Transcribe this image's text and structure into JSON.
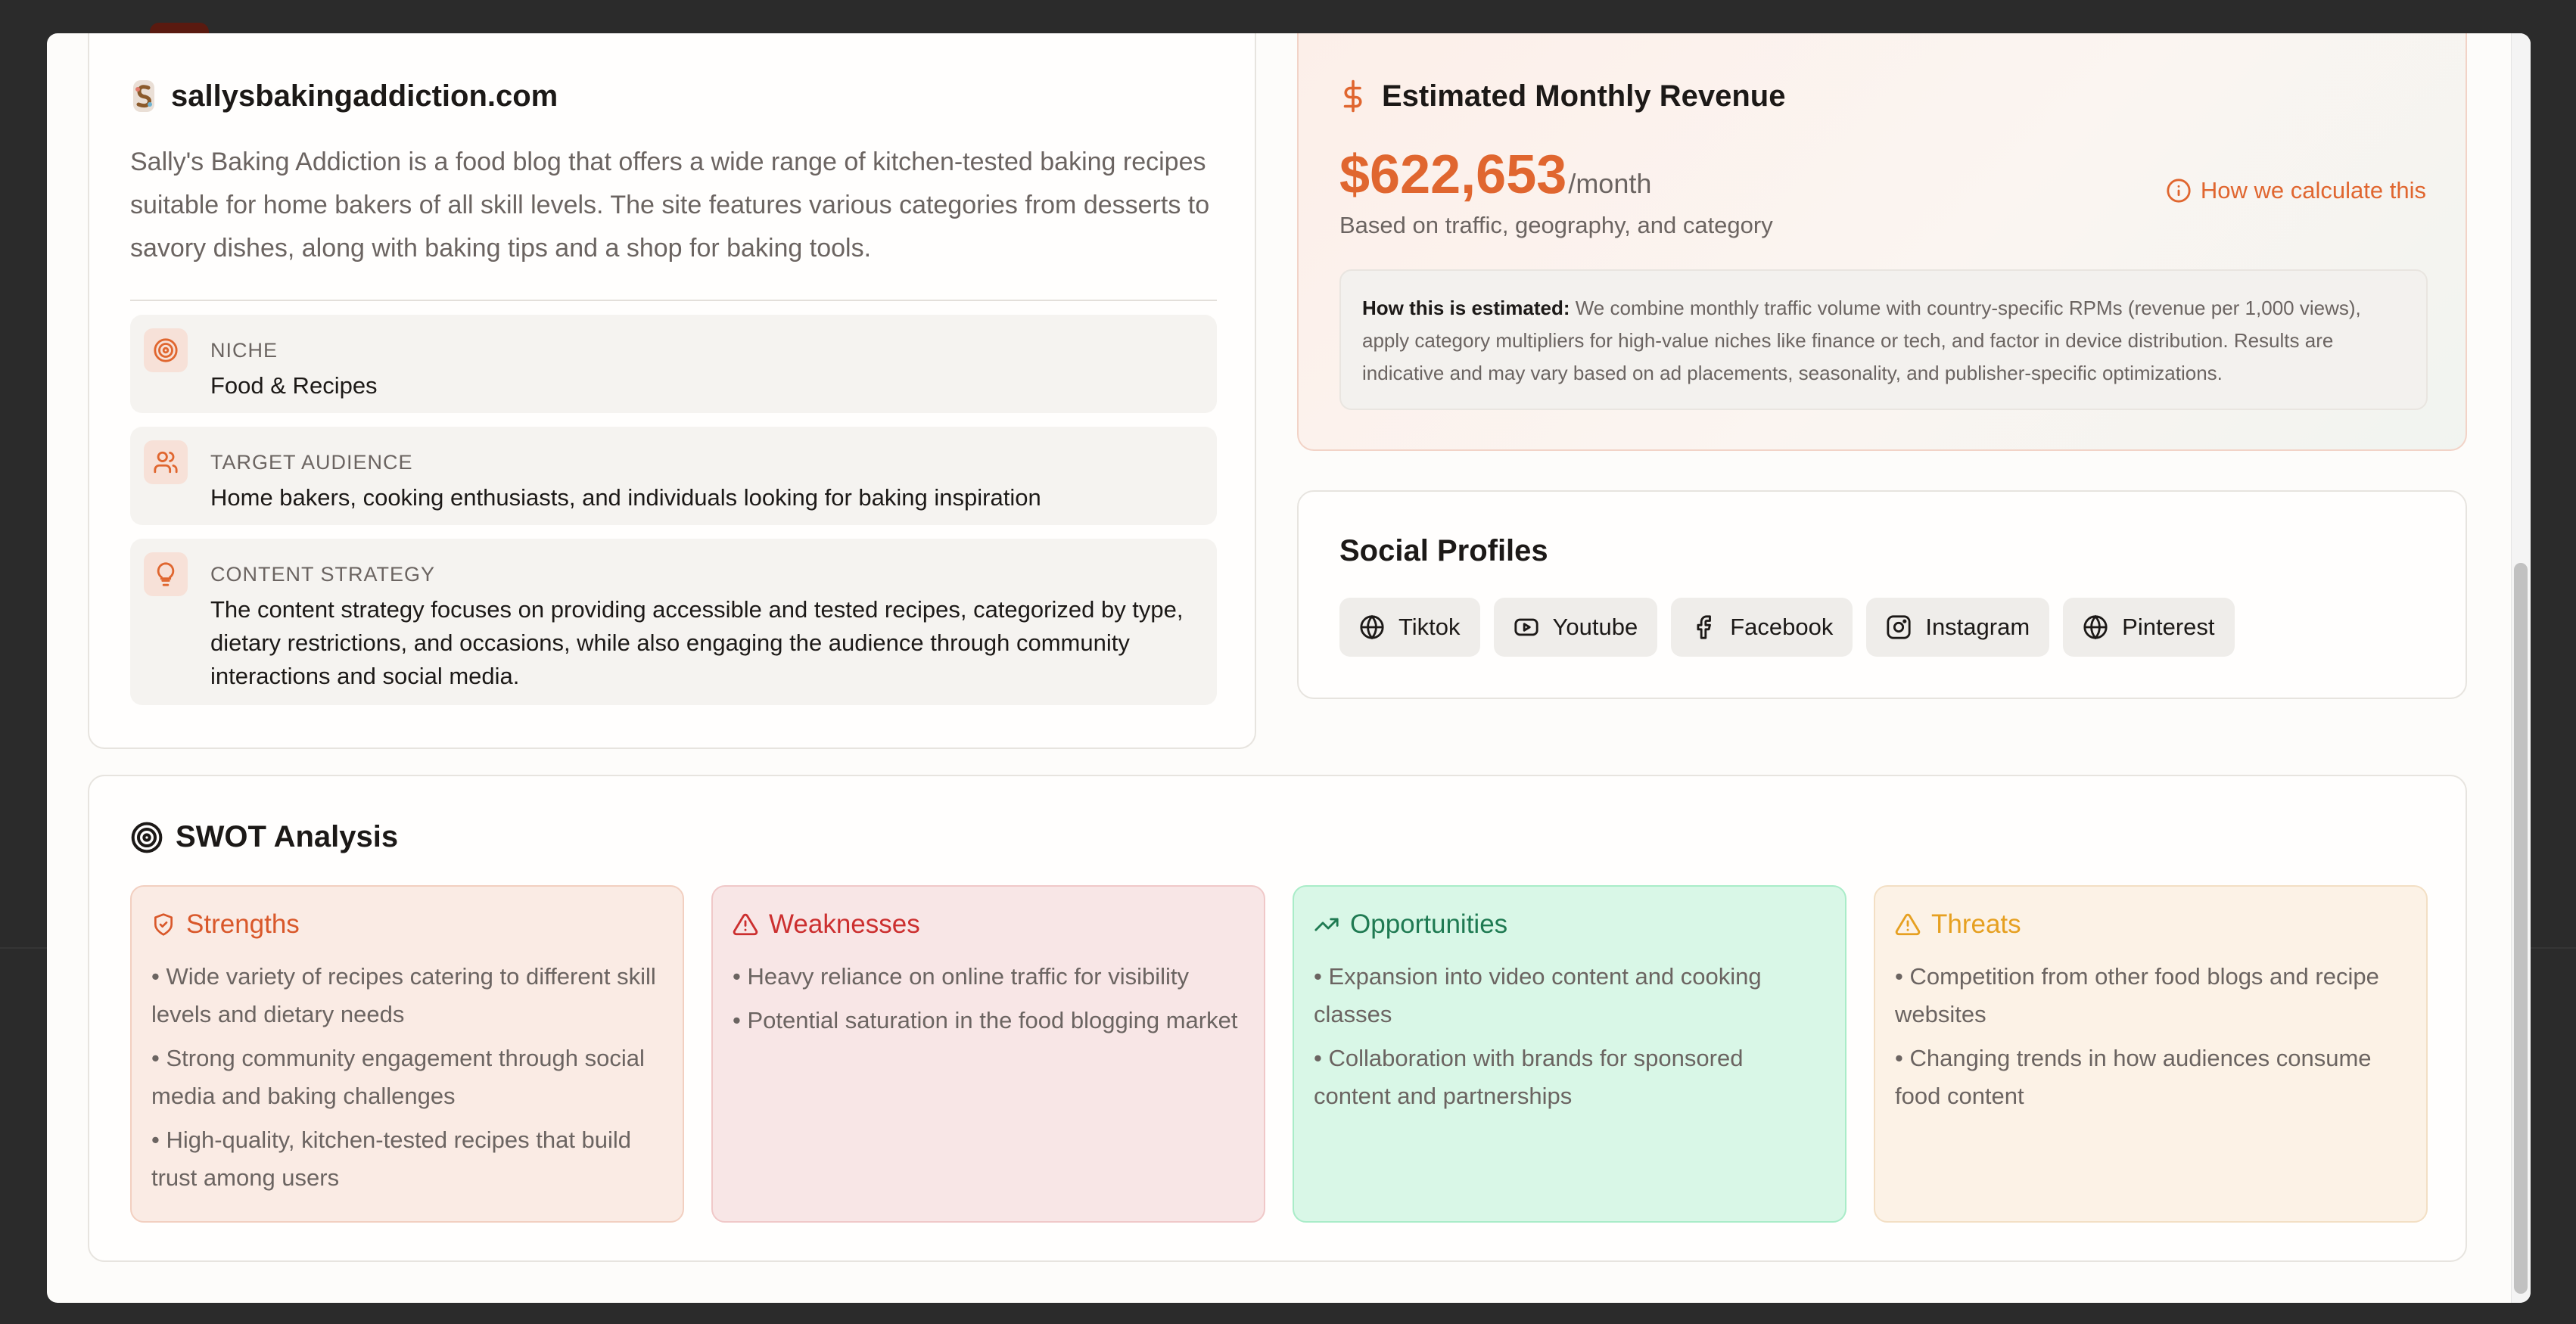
{
  "site": {
    "domain": "sallysbakingaddiction.com",
    "description": "Sally's Baking Addiction is a food blog that offers a wide range of kitchen-tested baking recipes suitable for home bakers of all skill levels. The site features various categories from desserts to savory dishes, along with baking tips and a shop for baking tools.",
    "details": [
      {
        "label": "NICHE",
        "value": "Food & Recipes",
        "icon": "target-icon"
      },
      {
        "label": "TARGET AUDIENCE",
        "value": "Home bakers, cooking enthusiasts, and individuals looking for baking inspiration",
        "icon": "users-icon"
      },
      {
        "label": "CONTENT STRATEGY",
        "value": "The content strategy focuses on providing accessible and tested recipes, categorized by type, dietary restrictions, and occasions, while also engaging the audience through community interactions and social media.",
        "icon": "lightbulb-icon"
      }
    ]
  },
  "revenue": {
    "title": "Estimated Monthly Revenue",
    "amount": "$622,653",
    "period": "/month",
    "basis": "Based on traffic, geography, and category",
    "link_label": "How we calculate this",
    "note_label": "How this is estimated:",
    "note_text": "We combine monthly traffic volume with country-specific RPMs (revenue per 1,000 views), apply category multipliers for high-value niches like finance or tech, and factor in device distribution. Results are indicative and may vary based on ad placements, seasonality, and publisher-specific optimizations."
  },
  "social": {
    "title": "Social Profiles",
    "profiles": [
      {
        "label": "Tiktok",
        "icon": "globe-icon"
      },
      {
        "label": "Youtube",
        "icon": "youtube-icon"
      },
      {
        "label": "Facebook",
        "icon": "facebook-icon"
      },
      {
        "label": "Instagram",
        "icon": "instagram-icon"
      },
      {
        "label": "Pinterest",
        "icon": "globe-icon"
      }
    ]
  },
  "swot": {
    "title": "SWOT Analysis",
    "strengths": {
      "title": "Strengths",
      "items": [
        "• Wide variety of recipes catering to different skill levels and dietary needs",
        "• Strong community engagement through social media and baking challenges",
        "• High-quality, kitchen-tested recipes that build trust among users"
      ]
    },
    "weaknesses": {
      "title": "Weaknesses",
      "items": [
        "• Heavy reliance on online traffic for visibility",
        "• Potential saturation in the food blogging market"
      ]
    },
    "opportunities": {
      "title": "Opportunities",
      "items": [
        "• Expansion into video content and cooking classes",
        "• Collaboration with brands for sponsored content and partnerships"
      ]
    },
    "threats": {
      "title": "Threats",
      "items": [
        "• Competition from other food blogs and recipe websites",
        "• Changing trends in how audiences consume food content"
      ]
    }
  },
  "colors": {
    "accent": "#e0662f",
    "strengths": "#d9582a",
    "weaknesses": "#cc2f2f",
    "opportunities": "#1f7a52",
    "threats": "#e6a021"
  }
}
